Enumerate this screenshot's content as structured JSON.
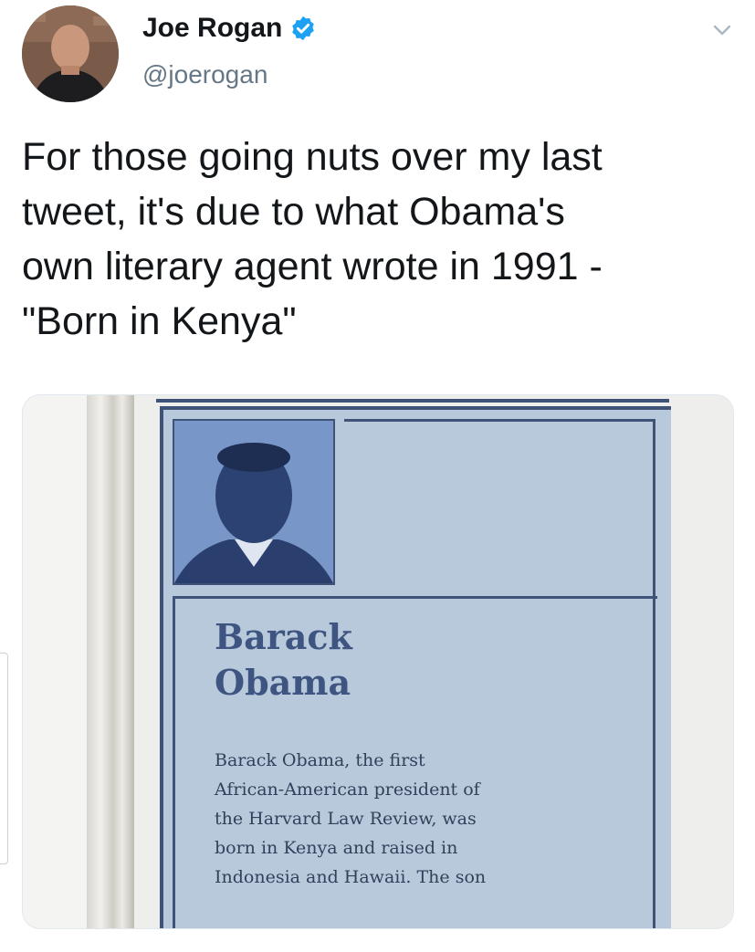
{
  "author": {
    "name": "Joe Rogan",
    "handle": "@joerogan",
    "verified": true
  },
  "tweet": {
    "lines": [
      "For those going nuts over my last",
      "tweet, it's due to what Obama's",
      "own literary agent wrote in 1991 -",
      "\"Born in Kenya\""
    ]
  },
  "media": {
    "title_lines": [
      "Barack",
      "Obama"
    ],
    "text_lines": [
      "Barack Obama, the first",
      "African-American president of",
      "the Harvard Law Review, was",
      "born in Kenya and raised in",
      "Indonesia and Hawaii.  The son"
    ]
  },
  "colors": {
    "verified_blue": "#1da1f2",
    "handle_gray": "#657786",
    "booklet_blue": "#b9c9dc",
    "booklet_ink": "#3d5580"
  },
  "icons": {
    "verified": "verified-badge-icon",
    "menu": "chevron-down-icon"
  }
}
